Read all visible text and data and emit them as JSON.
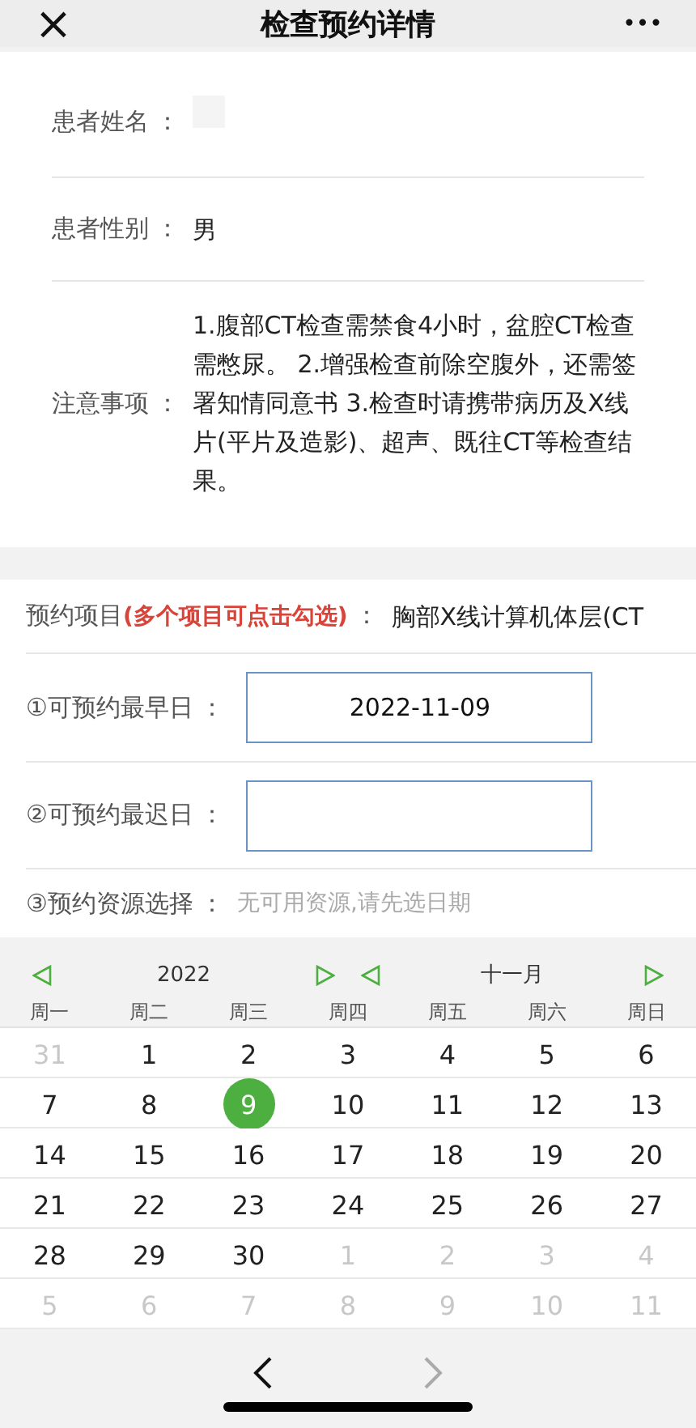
{
  "header": {
    "close": "×",
    "title": "检查预约详情",
    "more": "•••"
  },
  "patient": [
    {
      "label": "患者姓名",
      "colon": "："
    },
    {
      "label": "患者性别",
      "colon": "：",
      "value": "男"
    },
    {
      "label": "注意事项",
      "colon": "：",
      "value": "1.腹部CT检查需禁食4小时，盆腔CT检查需憋尿。 2.增强检查前除空腹外，还需签署知情同意书 3.检查时请携带病历及X线片(平片及造影)、超声、既往CT等检查结果。"
    }
  ],
  "booking": {
    "item": {
      "label": "预约项目",
      "hint": "(多个项目可点击勾选)",
      "colon": "：",
      "value": "胸部X线计算机体层(CT"
    },
    "earliest": {
      "label": "①可预约最早日",
      "colon": "：",
      "value": "2022-11-09"
    },
    "latest": {
      "label": "②可预约最迟日",
      "colon": "："
    },
    "resource": {
      "label": "③预约资源选择",
      "colon": "：",
      "value": "无可用资源,请先选日期"
    }
  },
  "calendar": {
    "year": "2022",
    "month": "十一月",
    "weekdays": [
      "周一",
      "周二",
      "周三",
      "周四",
      "周五",
      "周六",
      "周日"
    ],
    "weeks": [
      [
        {
          "day": "31",
          "other_month": true,
          "selected": false
        },
        {
          "day": "1",
          "other_month": false,
          "selected": false
        },
        {
          "day": "2",
          "other_month": false,
          "selected": false
        },
        {
          "day": "3",
          "other_month": false,
          "selected": false
        },
        {
          "day": "4",
          "other_month": false,
          "selected": false
        },
        {
          "day": "5",
          "other_month": false,
          "selected": false
        },
        {
          "day": "6",
          "other_month": false,
          "selected": false
        }
      ],
      [
        {
          "day": "7",
          "other_month": false,
          "selected": false
        },
        {
          "day": "8",
          "other_month": false,
          "selected": false
        },
        {
          "day": "9",
          "other_month": false,
          "selected": true
        },
        {
          "day": "10",
          "other_month": false,
          "selected": false
        },
        {
          "day": "11",
          "other_month": false,
          "selected": false
        },
        {
          "day": "12",
          "other_month": false,
          "selected": false
        },
        {
          "day": "13",
          "other_month": false,
          "selected": false
        }
      ],
      [
        {
          "day": "14",
          "other_month": false,
          "selected": false
        },
        {
          "day": "15",
          "other_month": false,
          "selected": false
        },
        {
          "day": "16",
          "other_month": false,
          "selected": false
        },
        {
          "day": "17",
          "other_month": false,
          "selected": false
        },
        {
          "day": "18",
          "other_month": false,
          "selected": false
        },
        {
          "day": "19",
          "other_month": false,
          "selected": false
        },
        {
          "day": "20",
          "other_month": false,
          "selected": false
        }
      ],
      [
        {
          "day": "21",
          "other_month": false,
          "selected": false
        },
        {
          "day": "22",
          "other_month": false,
          "selected": false
        },
        {
          "day": "23",
          "other_month": false,
          "selected": false
        },
        {
          "day": "24",
          "other_month": false,
          "selected": false
        },
        {
          "day": "25",
          "other_month": false,
          "selected": false
        },
        {
          "day": "26",
          "other_month": false,
          "selected": false
        },
        {
          "day": "27",
          "other_month": false,
          "selected": false
        }
      ],
      [
        {
          "day": "28",
          "other_month": false,
          "selected": false
        },
        {
          "day": "29",
          "other_month": false,
          "selected": false
        },
        {
          "day": "30",
          "other_month": false,
          "selected": false
        },
        {
          "day": "1",
          "other_month": true,
          "selected": false
        },
        {
          "day": "2",
          "other_month": true,
          "selected": false
        },
        {
          "day": "3",
          "other_month": true,
          "selected": false
        },
        {
          "day": "4",
          "other_month": true,
          "selected": false
        }
      ],
      [
        {
          "day": "5",
          "other_month": true,
          "selected": false
        },
        {
          "day": "6",
          "other_month": true,
          "selected": false
        },
        {
          "day": "7",
          "other_month": true,
          "selected": false
        },
        {
          "day": "8",
          "other_month": true,
          "selected": false
        },
        {
          "day": "9",
          "other_month": true,
          "selected": false
        },
        {
          "day": "10",
          "other_month": true,
          "selected": false
        },
        {
          "day": "11",
          "other_month": true,
          "selected": false
        }
      ]
    ]
  },
  "browser_nav": {
    "back_disabled": false,
    "forward_disabled": true
  }
}
